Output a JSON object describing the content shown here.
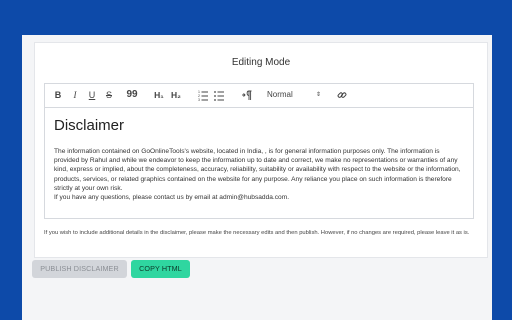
{
  "editor": {
    "mode_title": "Editing Mode",
    "toolbar": {
      "bold": "B",
      "italic": "I",
      "underline": "U",
      "strike": "S",
      "quote": "99",
      "h1": "H₁",
      "h2": "H₂",
      "format_select": "Normal",
      "icons": [
        "bold",
        "italic",
        "underline",
        "strikethrough",
        "blockquote",
        "heading-1",
        "heading-2",
        "ordered-list",
        "bullet-list",
        "text-direction",
        "link"
      ]
    },
    "document": {
      "title": "Disclaimer",
      "paragraph": "The information contained on GoOnlineTools's website, located in India, , is for general information purposes only. The information is provided by Rahul and while we endeavor to keep the information up to date and correct, we make no representations or warranties of any kind, express or implied, about the completeness, accuracy, reliability, suitability or availability with respect to the website or the information, products, services, or related graphics contained on the website for any purpose. Any reliance you place on such information is therefore strictly at your own risk.",
      "contact_line": "If you have any questions, please contact us by email at admin@hubsadda.com."
    }
  },
  "note": "If you wish to include additional details in the disclaimer, please make the necessary edits and then publish. However, if no changes are required, please leave it as is.",
  "buttons": {
    "publish": "PUBLISH DISCLAIMER",
    "copy": "COPY HTML"
  },
  "colors": {
    "background": "#0d4aa9",
    "copy_button": "#2fd6a0",
    "publish_button_disabled": "#d2d5da"
  }
}
